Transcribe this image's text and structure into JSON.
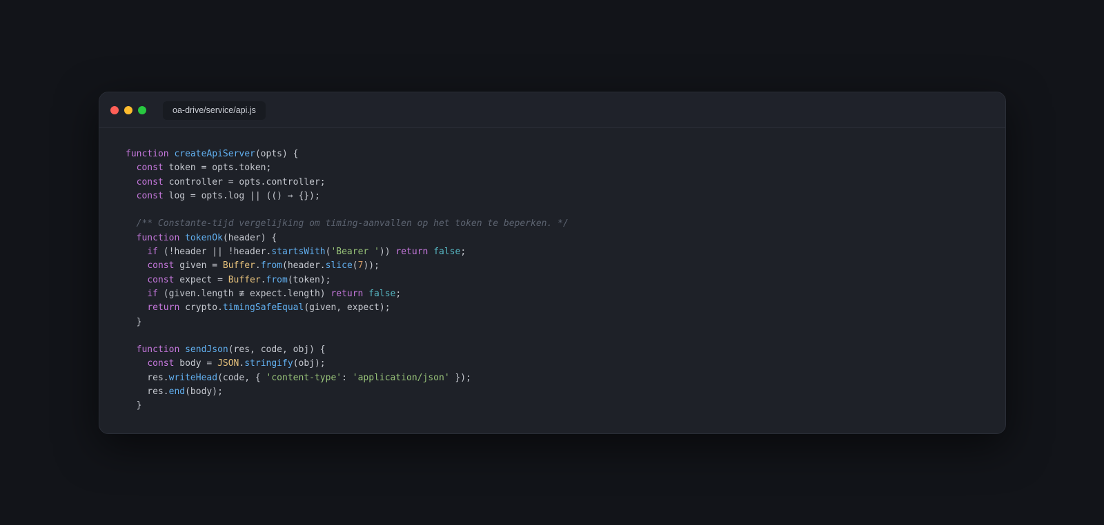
{
  "window": {
    "tab_title": "oa-drive/service/api.js",
    "traffic_lights": [
      {
        "name": "close",
        "color": "#ff5f57"
      },
      {
        "name": "minimize",
        "color": "#febc2e"
      },
      {
        "name": "zoom",
        "color": "#28c840"
      }
    ]
  },
  "colors": {
    "background": "#121419",
    "window": "#1e2128",
    "keyword": "#c678dd",
    "function": "#61afef",
    "class": "#e5c07b",
    "string": "#98c379",
    "number": "#d19a66",
    "boolean": "#56b6c2",
    "comment": "#5c6370",
    "text": "#c5c8cf"
  },
  "code": {
    "language": "javascript",
    "lines": [
      [
        [
          "kw",
          "function"
        ],
        [
          "plain",
          " "
        ],
        [
          "fn",
          "createApiServer"
        ],
        [
          "plain",
          "(opts) {"
        ]
      ],
      [
        [
          "plain",
          "  "
        ],
        [
          "kw",
          "const"
        ],
        [
          "plain",
          " token = opts.token;"
        ]
      ],
      [
        [
          "plain",
          "  "
        ],
        [
          "kw",
          "const"
        ],
        [
          "plain",
          " controller = opts.controller;"
        ]
      ],
      [
        [
          "plain",
          "  "
        ],
        [
          "kw",
          "const"
        ],
        [
          "plain",
          " log = opts.log || (() ⇒ {});"
        ]
      ],
      [],
      [
        [
          "plain",
          "  "
        ],
        [
          "cmt",
          "/** Constante-tijd vergelijking om timing-aanvallen op het token te beperken. */"
        ]
      ],
      [
        [
          "plain",
          "  "
        ],
        [
          "kw",
          "function"
        ],
        [
          "plain",
          " "
        ],
        [
          "fn",
          "tokenOk"
        ],
        [
          "plain",
          "(header) {"
        ]
      ],
      [
        [
          "plain",
          "    "
        ],
        [
          "kw",
          "if"
        ],
        [
          "plain",
          " (!header || !header."
        ],
        [
          "fn",
          "startsWith"
        ],
        [
          "plain",
          "("
        ],
        [
          "str",
          "'Bearer '"
        ],
        [
          "plain",
          ")) "
        ],
        [
          "kw",
          "return"
        ],
        [
          "plain",
          " "
        ],
        [
          "bool",
          "false"
        ],
        [
          "plain",
          ";"
        ]
      ],
      [
        [
          "plain",
          "    "
        ],
        [
          "kw",
          "const"
        ],
        [
          "plain",
          " given = "
        ],
        [
          "cls",
          "Buffer"
        ],
        [
          "plain",
          "."
        ],
        [
          "fn",
          "from"
        ],
        [
          "plain",
          "(header."
        ],
        [
          "fn",
          "slice"
        ],
        [
          "plain",
          "("
        ],
        [
          "num",
          "7"
        ],
        [
          "plain",
          "));"
        ]
      ],
      [
        [
          "plain",
          "    "
        ],
        [
          "kw",
          "const"
        ],
        [
          "plain",
          " expect = "
        ],
        [
          "cls",
          "Buffer"
        ],
        [
          "plain",
          "."
        ],
        [
          "fn",
          "from"
        ],
        [
          "plain",
          "(token);"
        ]
      ],
      [
        [
          "plain",
          "    "
        ],
        [
          "kw",
          "if"
        ],
        [
          "plain",
          " (given.length ≢ expect.length) "
        ],
        [
          "kw",
          "return"
        ],
        [
          "plain",
          " "
        ],
        [
          "bool",
          "false"
        ],
        [
          "plain",
          ";"
        ]
      ],
      [
        [
          "plain",
          "    "
        ],
        [
          "kw",
          "return"
        ],
        [
          "plain",
          " crypto."
        ],
        [
          "fn",
          "timingSafeEqual"
        ],
        [
          "plain",
          "(given, expect);"
        ]
      ],
      [
        [
          "plain",
          "  }"
        ]
      ],
      [],
      [
        [
          "plain",
          "  "
        ],
        [
          "kw",
          "function"
        ],
        [
          "plain",
          " "
        ],
        [
          "fn",
          "sendJson"
        ],
        [
          "plain",
          "(res, code, obj) {"
        ]
      ],
      [
        [
          "plain",
          "    "
        ],
        [
          "kw",
          "const"
        ],
        [
          "plain",
          " body = "
        ],
        [
          "cls",
          "JSON"
        ],
        [
          "plain",
          "."
        ],
        [
          "fn",
          "stringify"
        ],
        [
          "plain",
          "(obj);"
        ]
      ],
      [
        [
          "plain",
          "    res."
        ],
        [
          "fn",
          "writeHead"
        ],
        [
          "plain",
          "(code, { "
        ],
        [
          "str",
          "'content-type'"
        ],
        [
          "plain",
          ": "
        ],
        [
          "str",
          "'application/json'"
        ],
        [
          "plain",
          " });"
        ]
      ],
      [
        [
          "plain",
          "    res."
        ],
        [
          "fn",
          "end"
        ],
        [
          "plain",
          "(body);"
        ]
      ],
      [
        [
          "plain",
          "  }"
        ]
      ]
    ]
  }
}
